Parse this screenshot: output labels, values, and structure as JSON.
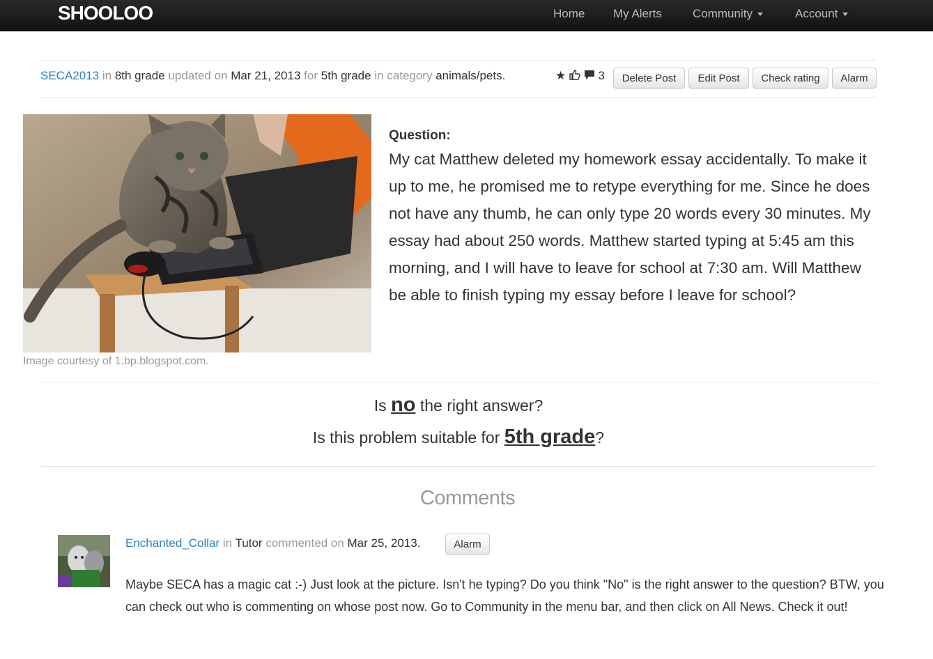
{
  "navbar": {
    "brand": "SHOOLOO",
    "items": [
      {
        "label": "Home"
      },
      {
        "label": "My Alerts"
      },
      {
        "label": "Community"
      },
      {
        "label": "Account"
      }
    ]
  },
  "post": {
    "author": "SECA2013",
    "in_text": "in",
    "author_grade": "8th grade",
    "updated_on_text": "updated on",
    "date": "Mar 21, 2013",
    "for_text": "for",
    "target_grade": "5th grade",
    "in_category_text": "in category",
    "category": "animals/pets.",
    "comment_count": "3",
    "buttons": {
      "delete": "Delete Post",
      "edit": "Edit Post",
      "check_rating": "Check rating",
      "alarm": "Alarm"
    },
    "image_caption": "Image courtesy of 1.bp.blogspot.com.",
    "question_label": "Question:",
    "question_text": "My cat Matthew deleted my homework essay accidentally. To make it up to me, he promised me to retype everything for me. Since he does not have any thumb, he can only type 20 words every 30 minutes. My essay had about 250 words. Matthew started typing at 5:45 am this morning, and I will have to leave for school at 7:30 am. Will Matthew be able to finish typing my essay before I leave for school?"
  },
  "review": {
    "line1_prefix": "Is",
    "answer": "no",
    "line1_suffix": "the right answer?",
    "line2_prefix": "Is this problem suitable for",
    "grade": "5th grade",
    "line2_suffix": "?"
  },
  "comments": {
    "title": "Comments",
    "items": [
      {
        "author": "Enchanted_Collar",
        "in_text": "in",
        "role": "Tutor",
        "commented_on_text": "commented on",
        "date": "Mar 25, 2013.",
        "alarm_label": "Alarm",
        "text": "Maybe SECA has a magic cat :-) Just look at the picture. Isn't he typing? Do you think \"No\" is the right answer to the question? BTW, you can check out who is commenting on whose post now. Go to Community in the menu bar, and then click on All News. Check it out!"
      }
    ]
  },
  "icons": [
    "star-icon",
    "thumbs-up-icon",
    "comment-icon"
  ],
  "colors": {
    "navbar_bg": "#1b1b1b",
    "link": "#2a7fc1",
    "muted": "#999999",
    "text": "#333333"
  }
}
